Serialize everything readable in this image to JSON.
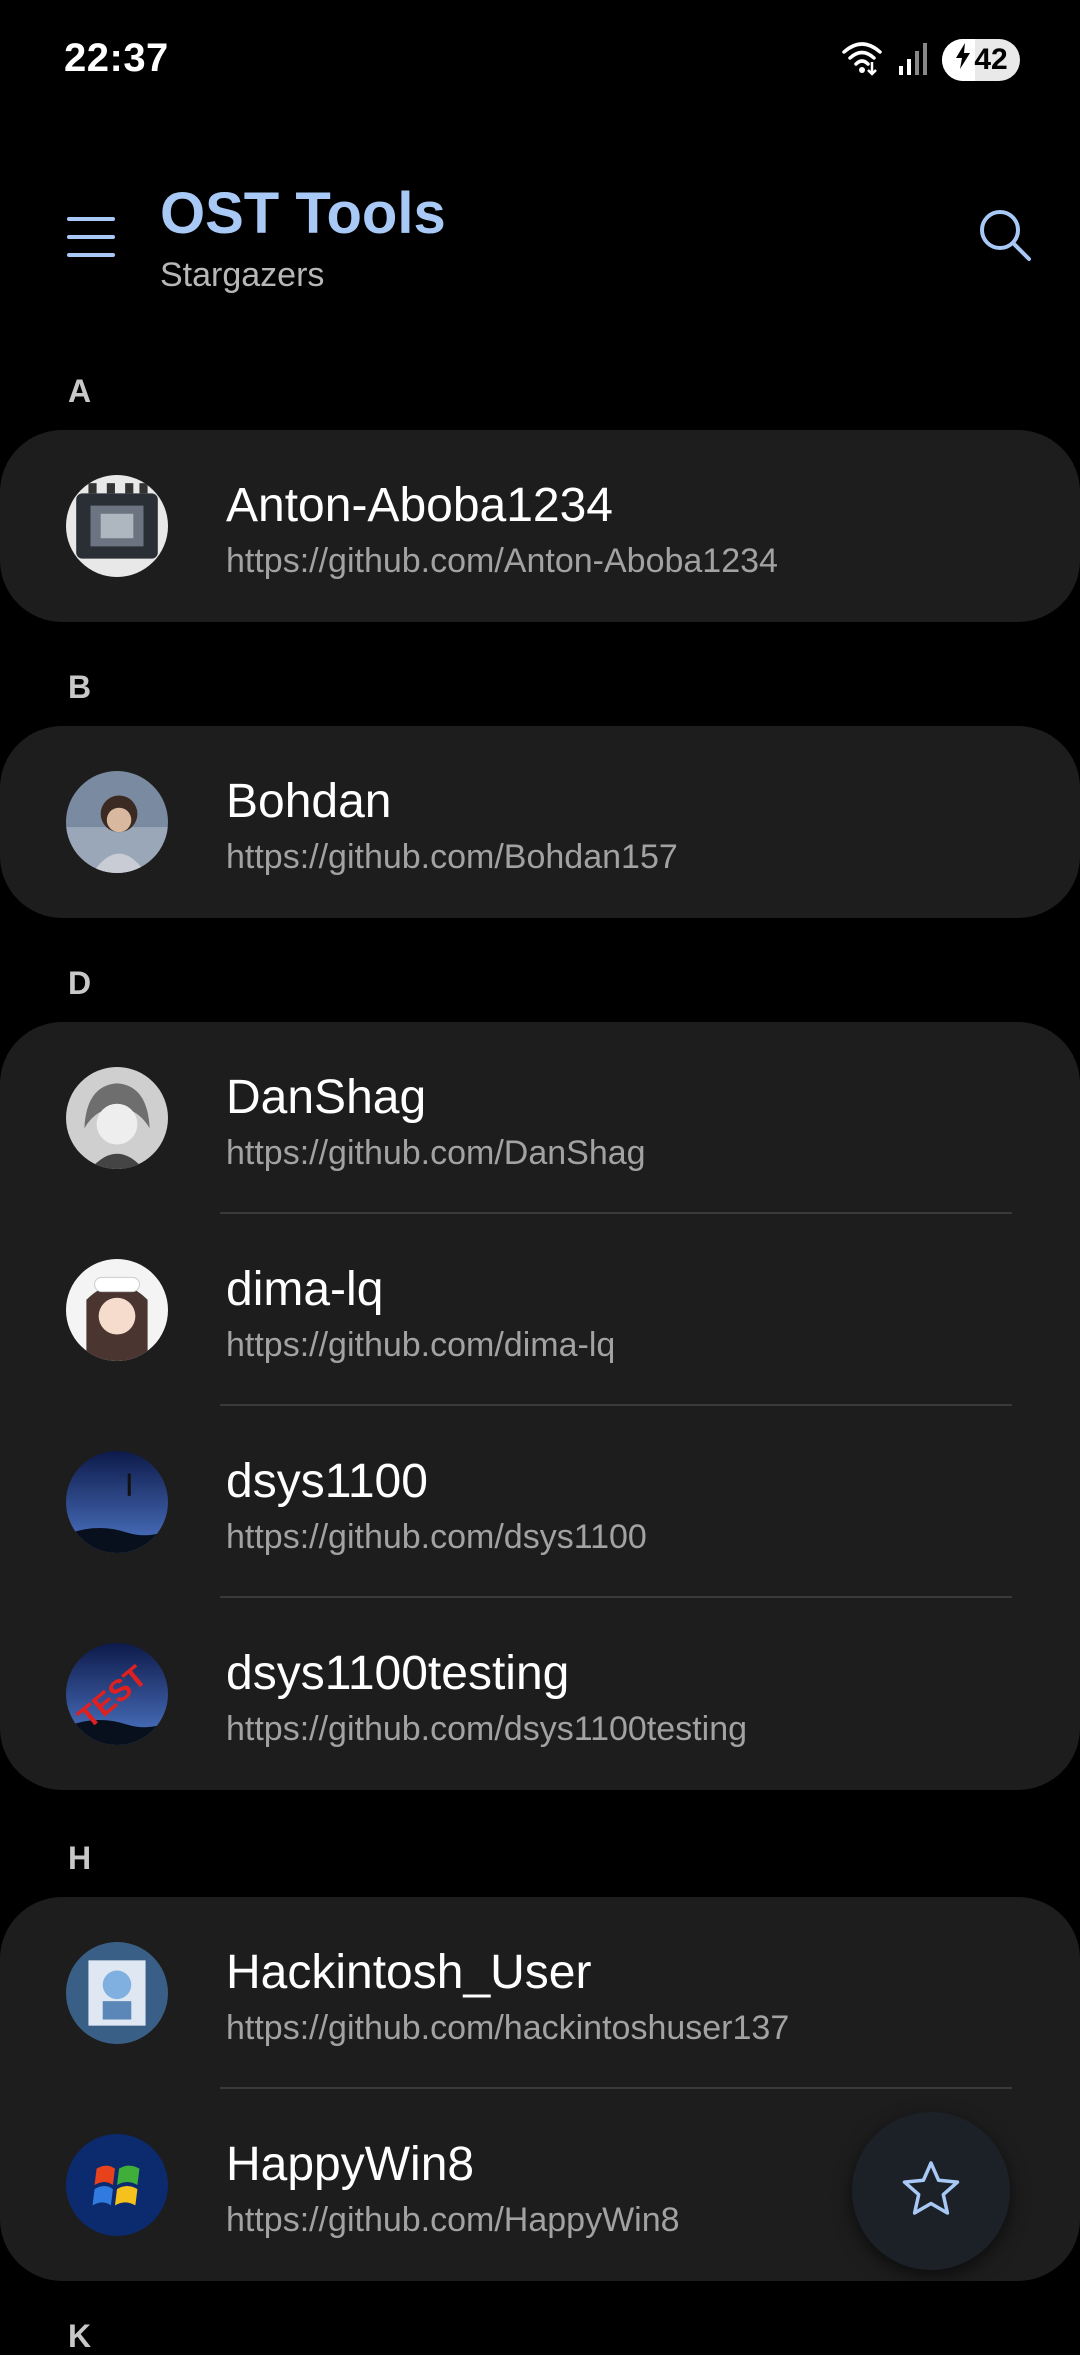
{
  "status_bar": {
    "time": "22:37",
    "battery_level": "42",
    "battery_fraction": 0.42
  },
  "header": {
    "title": "OST Tools",
    "subtitle": "Stargazers"
  },
  "sections": [
    {
      "letter": "A",
      "users": [
        {
          "name": "Anton-Aboba1234",
          "url": "https://github.com/Anton-Aboba1234"
        }
      ]
    },
    {
      "letter": "B",
      "users": [
        {
          "name": "Bohdan",
          "url": "https://github.com/Bohdan157"
        }
      ]
    },
    {
      "letter": "D",
      "users": [
        {
          "name": "DanShag",
          "url": "https://github.com/DanShag"
        },
        {
          "name": "dima-lq",
          "url": "https://github.com/dima-lq"
        },
        {
          "name": "dsys1100",
          "url": "https://github.com/dsys1100"
        },
        {
          "name": "dsys1100testing",
          "url": "https://github.com/dsys1100testing"
        }
      ]
    },
    {
      "letter": "H",
      "users": [
        {
          "name": "Hackintosh_User",
          "url": "https://github.com/hackintoshuser137"
        },
        {
          "name": "HappyWin8",
          "url": "https://github.com/HappyWin8"
        }
      ]
    }
  ],
  "next_section_letter": "K",
  "avatar_test_text": "TEST",
  "colors": {
    "accent": "#a8c8f5",
    "card": "#1d1d1d",
    "background": "#000000"
  }
}
